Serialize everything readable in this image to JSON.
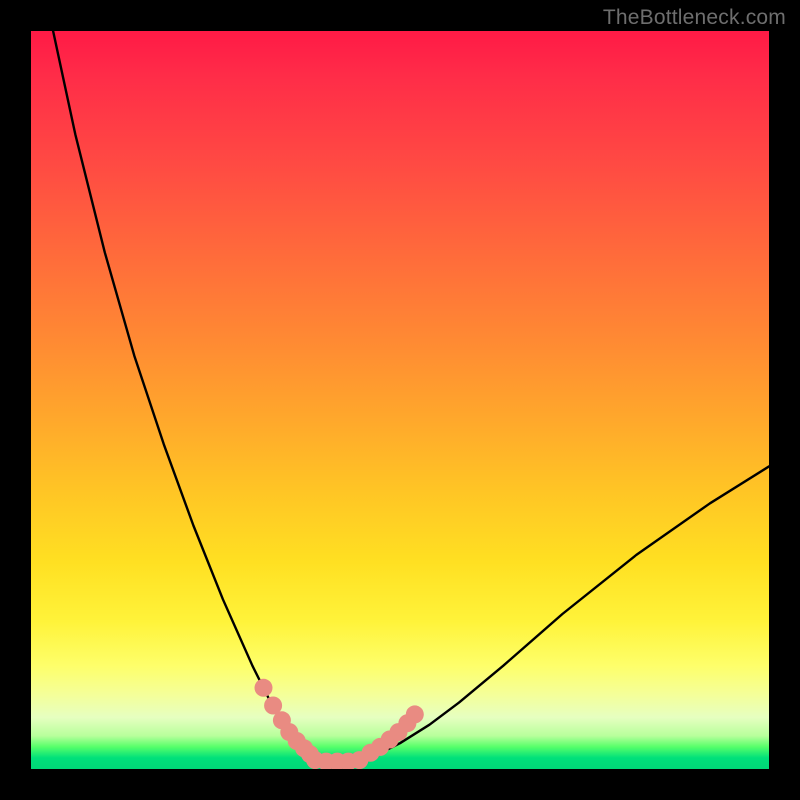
{
  "watermark": "TheBottleneck.com",
  "chart_data": {
    "type": "line",
    "title": "",
    "xlabel": "",
    "ylabel": "",
    "xlim": [
      0,
      100
    ],
    "ylim": [
      0,
      100
    ],
    "series": [
      {
        "name": "bottleneck-curve",
        "x": [
          3,
          6,
          10,
          14,
          18,
          22,
          26,
          30,
          33,
          35,
          37,
          39,
          41,
          43,
          45,
          47,
          50,
          54,
          58,
          64,
          72,
          82,
          92,
          100
        ],
        "y": [
          100,
          86,
          70,
          56,
          44,
          33,
          23,
          14,
          8,
          5,
          3,
          1.5,
          1,
          1,
          1.2,
          2,
          3.5,
          6,
          9,
          14,
          21,
          29,
          36,
          41
        ]
      }
    ],
    "markers": [
      {
        "name": "segment-left",
        "color": "#e98b82",
        "x": [
          31.5,
          32.8,
          34.0,
          35.0,
          36.0,
          37.0,
          37.8
        ],
        "y": [
          11.0,
          8.6,
          6.6,
          5.0,
          3.8,
          2.8,
          2.0
        ]
      },
      {
        "name": "flat-bottom",
        "color": "#e98b82",
        "x": [
          38.5,
          40.0,
          41.5,
          43.0,
          44.5
        ],
        "y": [
          1.2,
          1.0,
          1.0,
          1.0,
          1.2
        ]
      },
      {
        "name": "segment-right",
        "color": "#e98b82",
        "x": [
          46.0,
          47.3,
          48.6,
          49.8,
          51.0,
          52.0
        ],
        "y": [
          2.2,
          3.0,
          4.0,
          5.0,
          6.2,
          7.4
        ]
      }
    ]
  }
}
